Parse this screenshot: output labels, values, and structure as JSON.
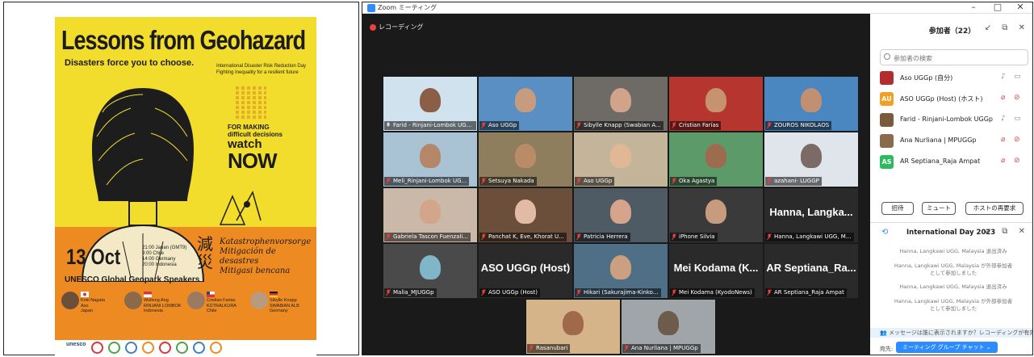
{
  "poster": {
    "title": "Lessons from Geohazard",
    "subtitle": "Disasters force you to choose.",
    "event_line1": "International Disaster Risk Reduction Day",
    "event_line2": "Fighting Inequality for a resilient future",
    "cta_line1": "FOR MAKING",
    "cta_line2": "difficult decisions",
    "cta_line3": "watch",
    "cta_line4": "NOW",
    "date": "13 Oct",
    "times": [
      "21:00 Japan (GMT9)",
      "9:00 Chile",
      "14:00 Germany",
      "20:00 Indonesia"
    ],
    "organizer": "UNESCO Global Geopark Speakers",
    "kanji": "減災",
    "hazard_words": [
      "Katastrophenvorsorge",
      "Mitigación de desastres",
      "Mitigasi bencana"
    ],
    "speakers": [
      {
        "name": "Koki Nagata",
        "place": "Aso",
        "country": "Japan"
      },
      {
        "name": "Wulleng Ang",
        "place": "RINJANI LOMBOK",
        "country": "Indonesia"
      },
      {
        "name": "Cristian Farias",
        "place": "KÜTRALKURA",
        "country": "Chile"
      },
      {
        "name": "Sibylle Knapp",
        "place": "SWABIAN ALB",
        "country": "Germany"
      }
    ],
    "logo_text": "unesco"
  },
  "zoom": {
    "window_title": "Zoom ミーティング",
    "window_controls": [
      "–",
      "□",
      "✕"
    ],
    "recording_label": "レコーディング",
    "tiles": [
      {
        "name": "Farid - Rinjani-Lombok UGGp",
        "kind": "video",
        "bg": "#cfe2ee",
        "skin": "#8a5f45",
        "mic": "on"
      },
      {
        "name": "Aso UGGp",
        "kind": "video",
        "bg": "#5a8fc4",
        "skin": "#c79b7d",
        "mic": "off",
        "active": true
      },
      {
        "name": "Sibylle Knapp (Swabian A...",
        "kind": "video",
        "bg": "#6e6a66",
        "skin": "#d1a388",
        "mic": "off"
      },
      {
        "name": "Cristian Farías",
        "kind": "video",
        "bg": "#b6352f",
        "skin": "#c6936f",
        "mic": "off"
      },
      {
        "name": "ZOUROS NIKOLAOS",
        "kind": "video",
        "bg": "#4a86c0",
        "skin": "#c09070",
        "mic": "off"
      },
      {
        "name": "Meli_Rinjani-Lombok UG...",
        "kind": "video",
        "bg": "#a9c3d4",
        "skin": "#b4876a",
        "mic": "off"
      },
      {
        "name": "Setsuya Nakada",
        "kind": "video",
        "bg": "#8f7e5e",
        "skin": "#b98b66",
        "mic": "off"
      },
      {
        "name": "Aso UGGp",
        "kind": "video",
        "bg": "#c4b49a",
        "skin": "#e0b896",
        "mic": "off"
      },
      {
        "name": "Oka Agastya",
        "kind": "video",
        "bg": "#5d9a6a",
        "skin": "#9d6c4e",
        "mic": "off"
      },
      {
        "name": "azahani- LUGGP",
        "kind": "video",
        "bg": "#dfe5ea",
        "skin": "#7c6a66",
        "mic": "off"
      },
      {
        "name": "Gabriela Tascon Fuenzali...",
        "kind": "video",
        "bg": "#cab8a8",
        "skin": "#d3a58b",
        "mic": "off"
      },
      {
        "name": "Panchat K, Eve, Khorat U...",
        "kind": "video",
        "bg": "#6b4f3b",
        "skin": "#e3bba4",
        "mic": "off"
      },
      {
        "name": "Patricia Herrera",
        "kind": "video",
        "bg": "#4e5a64",
        "skin": "#d6a48b",
        "mic": "off"
      },
      {
        "name": "iPhone Silvia",
        "kind": "video",
        "bg": "#3a3a3a",
        "skin": "#c79b7d",
        "mic": "off"
      },
      {
        "name": "Hanna, Langkawi UGG, M...",
        "kind": "name",
        "label": "Hanna, Langka...",
        "mic": "off"
      },
      {
        "name": "Malia_MJUGGp",
        "kind": "video",
        "bg": "#4a4a4a",
        "skin": "#7fb7c9",
        "mic": "off"
      },
      {
        "name": "ASO UGGp (Host)",
        "kind": "name",
        "label": "ASO UGGp (Host)",
        "mic": "off"
      },
      {
        "name": "Hikari (Sakurajima-Kinko...",
        "kind": "video",
        "bg": "#4e6f86",
        "skin": "#cba081",
        "mic": "off"
      },
      {
        "name": "Mei Kodama (KyodoNews)",
        "kind": "name",
        "label": "Mei Kodama (K...",
        "mic": "off"
      },
      {
        "name": "AR Septiana_Raja Ampat",
        "kind": "name",
        "label": "AR Septiana_Ra...",
        "mic": "off"
      },
      {
        "name": "Rasanubari",
        "kind": "video",
        "bg": "#d6b48a",
        "skin": "#a06a4a",
        "mic": "off"
      },
      {
        "name": "Ana Nurliana | MPUGGp",
        "kind": "video",
        "bg": "#9fa5a9",
        "skin": "#6d5b4b",
        "mic": "off"
      }
    ]
  },
  "sidebar": {
    "title": "参加者（22）",
    "header_icons": [
      "↙",
      "⧉",
      "✕"
    ],
    "search_placeholder": "参加者の検索",
    "participants": [
      {
        "name": "Aso UGGp (自分)",
        "avatar": "",
        "avatar_color": "#b22e2e",
        "mic": "on",
        "video": "on"
      },
      {
        "name": "ASO UGGp (Host) (ホスト)",
        "avatar": "AU",
        "avatar_color": "#f1a024",
        "mic": "off",
        "video": "off"
      },
      {
        "name": "Farid - Rinjani-Lombok UGGp",
        "avatar": "",
        "avatar_color": "#7a5a3a",
        "mic": "on",
        "video": "on"
      },
      {
        "name": "Ana Nurliana | MPUGGp",
        "avatar": "",
        "avatar_color": "#8a6a4a",
        "mic": "off",
        "video": "off"
      },
      {
        "name": "AR Septiana_Raja Ampat",
        "avatar": "AS",
        "avatar_color": "#2dbb5f",
        "mic": "off",
        "video": "off"
      }
    ],
    "buttons": [
      "招待",
      "ミュート",
      "ホストの再要求"
    ],
    "chat_title": "International Day 2023",
    "chat_messages": [
      "Hanna, Langkawi UGG, Malaysia 退出済み",
      "Hanna, Langkawi UGG, Malaysia が外部参加者\nとして参加しました",
      "Hanna, Langkawi UGG, Malaysia 退出済み",
      "Hanna, Langkawi UGG, Malaysia が外部参加者\nとして参加しました"
    ],
    "chat_notice": "メッセージは誰に表示されますか？レコーディングが有効",
    "send_to_label": "宛先:",
    "send_to_value": "ミーティング グループ チャット ⌄"
  }
}
